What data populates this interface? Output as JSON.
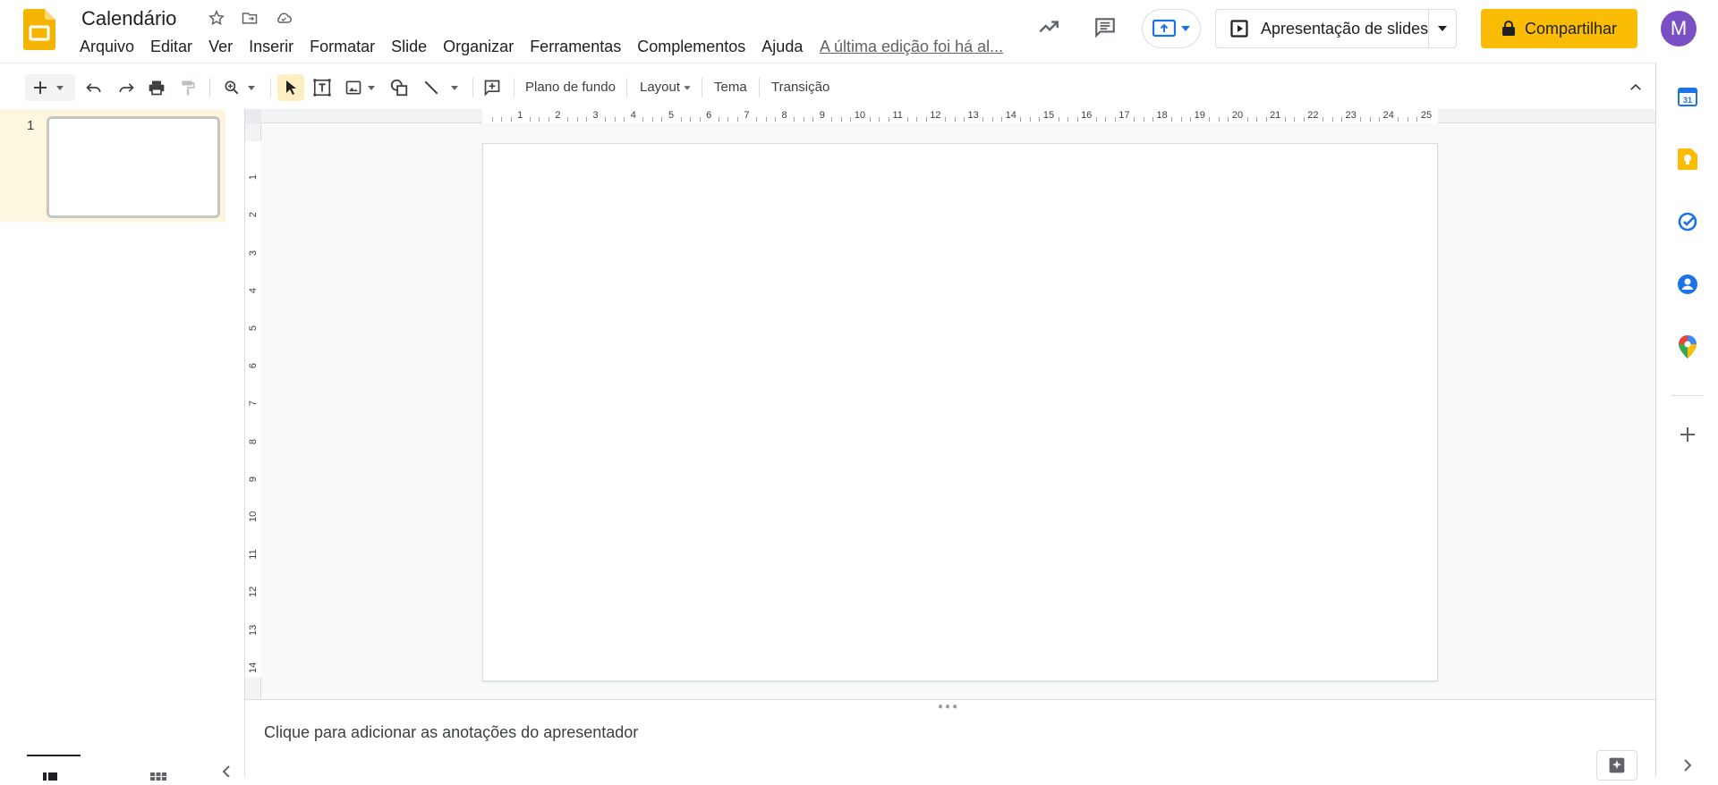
{
  "header": {
    "doc_title": "Calendário",
    "menu": [
      "Arquivo",
      "Editar",
      "Ver",
      "Inserir",
      "Formatar",
      "Slide",
      "Organizar",
      "Ferramentas",
      "Complementos",
      "Ajuda"
    ],
    "last_edit": "A última edição foi há al...",
    "slideshow_label": "Apresentação de slides",
    "share_label": "Compartilhar",
    "avatar_initial": "M"
  },
  "toolbar": {
    "background_label": "Plano de fundo",
    "layout_label": "Layout",
    "theme_label": "Tema",
    "transition_label": "Transição"
  },
  "filmstrip": {
    "slide_numbers": [
      "1"
    ]
  },
  "rulers": {
    "horizontal": [
      "1",
      "2",
      "3",
      "4",
      "5",
      "6",
      "7",
      "8",
      "9",
      "10",
      "11",
      "12",
      "13",
      "14",
      "15",
      "16",
      "17",
      "18",
      "19",
      "20",
      "21",
      "22",
      "23",
      "24",
      "25"
    ],
    "vertical": [
      "1",
      "2",
      "3",
      "4",
      "5",
      "6",
      "7",
      "8",
      "9",
      "10",
      "11",
      "12",
      "13",
      "14"
    ]
  },
  "notes": {
    "placeholder": "Clique para adicionar as anotações do apresentador"
  },
  "colors": {
    "accent_yellow": "#fbbc04",
    "selection_bg": "#fef7e0",
    "avatar_bg": "#7b4fc4",
    "blue": "#1a73e8"
  },
  "side_panel": {
    "icons": [
      "calendar-icon",
      "keep-icon",
      "tasks-icon",
      "contacts-icon",
      "maps-icon",
      "add-icon"
    ]
  }
}
